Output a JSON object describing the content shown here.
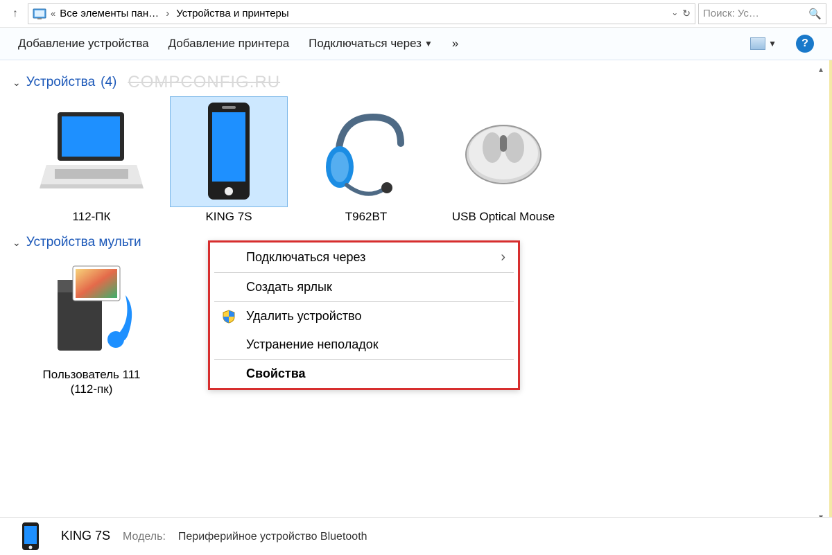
{
  "breadcrumb": {
    "part1": "Все элементы пан…",
    "part2": "Устройства и принтеры"
  },
  "search": {
    "placeholder": "Поиск: Ус…"
  },
  "toolbar": {
    "add_device": "Добавление устройства",
    "add_printer": "Добавление принтера",
    "connect_via": "Подключаться через",
    "more": "»"
  },
  "groups": {
    "devices": {
      "label": "Устройства",
      "count": "(4)"
    },
    "media": {
      "label": "Устройства мульти"
    }
  },
  "watermark": "COMPCONFIG.RU",
  "devices": [
    {
      "label": "112-ПК"
    },
    {
      "label": "KING 7S"
    },
    {
      "label": "T962BT"
    },
    {
      "label": "USB Optical Mouse"
    }
  ],
  "media_devices": [
    {
      "label": "Пользователь 111 (112-пк)"
    }
  ],
  "context_menu": {
    "connect_via": "Подключаться через",
    "create_shortcut": "Создать ярлык",
    "remove_device": "Удалить устройство",
    "troubleshoot": "Устранение неполадок",
    "properties": "Свойства"
  },
  "details": {
    "name": "KING 7S",
    "model_label": "Модель:",
    "model_value": "Периферийное устройство Bluetooth"
  }
}
